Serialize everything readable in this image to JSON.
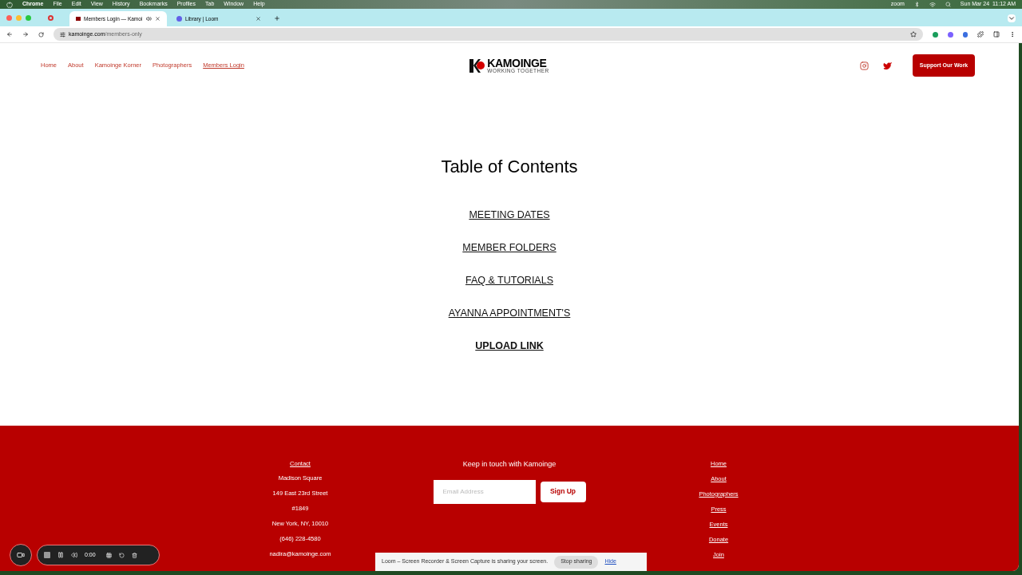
{
  "menubar": {
    "app": "Chrome",
    "items": [
      "File",
      "Edit",
      "View",
      "History",
      "Bookmarks",
      "Profiles",
      "Tab",
      "Window",
      "Help"
    ],
    "zoom": "zoom",
    "clock": "Sun Mar 24  11:12 AM"
  },
  "browser_tabs": [
    {
      "title": "Members Login — Kamoi",
      "selected": true,
      "kind": "site"
    },
    {
      "title": "Library | Loom",
      "selected": false,
      "kind": "loom"
    }
  ],
  "address": {
    "domain": "kamoinge.com",
    "path": "/members-only"
  },
  "nav": {
    "items": [
      {
        "label": "Home",
        "selected": false
      },
      {
        "label": "About",
        "selected": false
      },
      {
        "label": "Kamoinge Korner",
        "selected": false
      },
      {
        "label": "Photographers",
        "selected": false
      },
      {
        "label": "Members Login",
        "selected": true
      }
    ],
    "logo": {
      "name": "KAMOINGE",
      "tagline": "WORKING TOGETHER"
    },
    "button": "Support Our Work"
  },
  "toc": {
    "title": "Table of Contents",
    "links": [
      {
        "label": "MEETING DATES",
        "bold": false
      },
      {
        "label": "MEMBER FOLDERS",
        "bold": false
      },
      {
        "label": "FAQ & TUTORIALS",
        "bold": false
      },
      {
        "label": "AYANNA APPOINTMENT'S",
        "bold": false
      },
      {
        "label": "UPLOAD LINK",
        "bold": true
      }
    ]
  },
  "footer": {
    "contact": {
      "heading": "Contact",
      "lines": [
        "Madison Square",
        "149 East 23rd Street",
        "#1849",
        "New York, NY, 10010",
        "(646) 228-4580",
        "nadira@kamoinge.com"
      ]
    },
    "newsletter": {
      "heading": "Keep in touch with Kamoinge",
      "placeholder": "Email Address",
      "button": "Sign Up"
    },
    "links": [
      "Home",
      "About",
      "Photographers",
      "Press",
      "Events",
      "Donate",
      "Join"
    ]
  },
  "recorder": {
    "time": "0:00"
  },
  "share_bar": {
    "message": "Loom – Screen Recorder & Screen Capture is sharing your screen.",
    "stop": "Stop sharing",
    "hide": "Hide"
  }
}
